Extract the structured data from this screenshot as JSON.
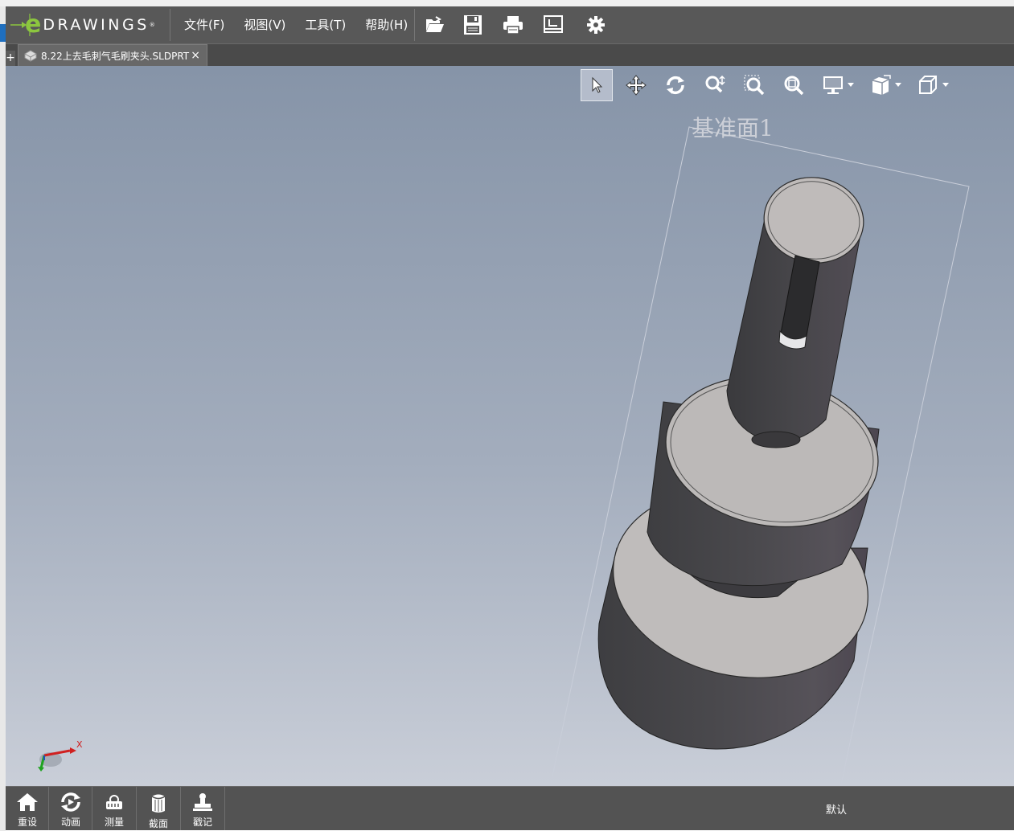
{
  "app": {
    "logo_letter": "e",
    "logo_text": "DRAWINGS",
    "accent_color": "#8cc63f"
  },
  "menu": {
    "file": "文件(F)",
    "view": "视图(V)",
    "tools": "工具(T)",
    "help": "帮助(H)"
  },
  "toolbar_icons": [
    "open-icon",
    "save-icon",
    "print-icon",
    "page-setup-icon",
    "settings-icon"
  ],
  "tabs": {
    "plus": "+",
    "document_title": "8.22上去毛刺气毛刷夹头.SLDPRT",
    "close": "×"
  },
  "hud_icons": [
    "select-icon",
    "pan-icon",
    "rotate-icon",
    "zoom-icon",
    "zoom-to-area-icon",
    "zoom-to-fit-icon",
    "display-style-icon",
    "view-orientation-icon",
    "standard-views-icon"
  ],
  "viewport": {
    "plane_label": "基准面1",
    "triad_x_label": "X"
  },
  "bottom_tools": {
    "reset": "重设",
    "animate": "动画",
    "measure": "测量",
    "section": "截面",
    "markup": "戳记"
  },
  "configuration": "默认"
}
